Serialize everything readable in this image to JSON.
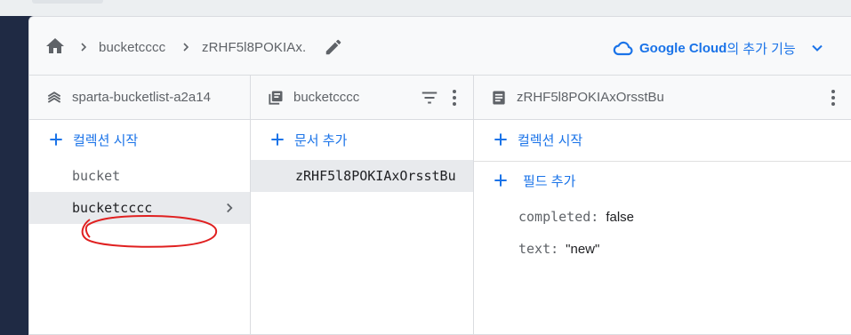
{
  "breadcrumb": {
    "items": [
      "bucketcccc",
      "zRHF5l8POKIAx."
    ]
  },
  "google_cloud": {
    "brand": "Google Cloud",
    "rest": "의 추가 기능"
  },
  "columns": {
    "project": {
      "title": "sparta-bucketlist-a2a14",
      "add_label": "컬렉션 시작",
      "items": [
        "bucket",
        "bucketcccc"
      ],
      "selected_index": 1
    },
    "collection": {
      "title": "bucketcccc",
      "add_label": "문서 추가",
      "items": [
        "zRHF5l8POKIAxOrsstBu"
      ]
    },
    "document": {
      "title": "zRHF5l8POKIAxOrsstBu",
      "add_collection_label": "컬렉션 시작",
      "add_field_label": "필드 추가",
      "fields": [
        {
          "key": "completed:",
          "value": "false"
        },
        {
          "key": "text:",
          "value": "\"new\""
        }
      ]
    }
  },
  "colors": {
    "accent": "#1a73e8",
    "annotation": "#e02020",
    "selected_row": "#e8eaed"
  }
}
